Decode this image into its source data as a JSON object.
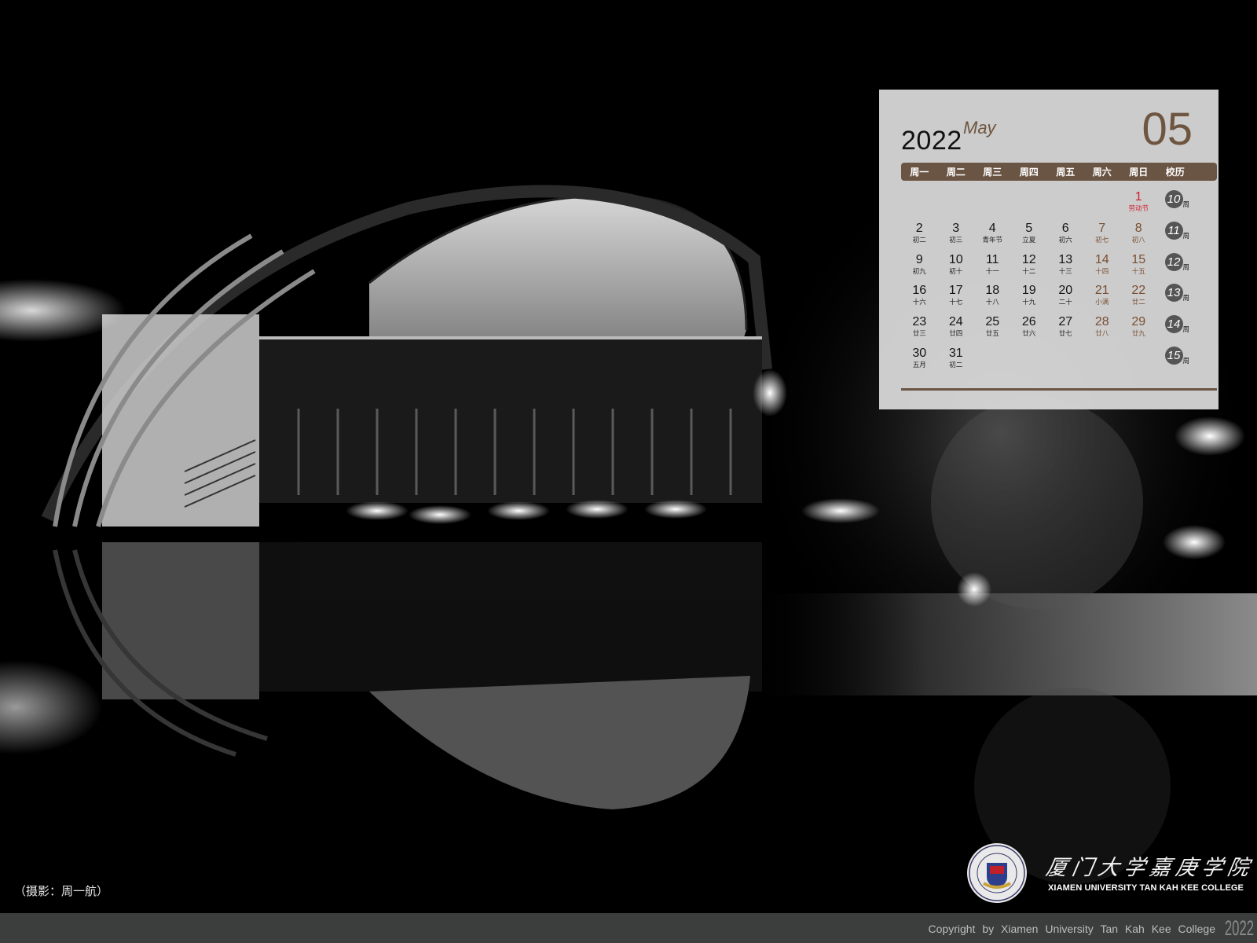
{
  "photo": {
    "subject": "night-reflection-building-photo",
    "tones": {
      "dark": "#000000",
      "light": "#f0f0f0",
      "mid": "#6a6a6a"
    }
  },
  "calendar": {
    "year": "2022",
    "month_en": "May",
    "month_num": "05",
    "colors": {
      "accent": "#6a5443",
      "weekend": "#7a4e31",
      "holiday": "#d11e2b"
    },
    "headers": [
      "周一",
      "周二",
      "周三",
      "周四",
      "周五",
      "周六",
      "周日",
      "校历"
    ],
    "weeks": [
      {
        "days": [
          {
            "n": "",
            "l": ""
          },
          {
            "n": "",
            "l": ""
          },
          {
            "n": "",
            "l": ""
          },
          {
            "n": "",
            "l": ""
          },
          {
            "n": "",
            "l": ""
          },
          {
            "n": "",
            "l": ""
          },
          {
            "n": "1",
            "l": "劳动节"
          }
        ],
        "week_no": "10",
        "suffix": "周"
      },
      {
        "days": [
          {
            "n": "2",
            "l": "初二"
          },
          {
            "n": "3",
            "l": "初三"
          },
          {
            "n": "4",
            "l": "青年节"
          },
          {
            "n": "5",
            "l": "立夏"
          },
          {
            "n": "6",
            "l": "初六"
          },
          {
            "n": "7",
            "l": "初七"
          },
          {
            "n": "8",
            "l": "初八"
          }
        ],
        "week_no": "11",
        "suffix": "周"
      },
      {
        "days": [
          {
            "n": "9",
            "l": "初九"
          },
          {
            "n": "10",
            "l": "初十"
          },
          {
            "n": "11",
            "l": "十一"
          },
          {
            "n": "12",
            "l": "十二"
          },
          {
            "n": "13",
            "l": "十三"
          },
          {
            "n": "14",
            "l": "十四"
          },
          {
            "n": "15",
            "l": "十五"
          }
        ],
        "week_no": "12",
        "suffix": "周"
      },
      {
        "days": [
          {
            "n": "16",
            "l": "十六"
          },
          {
            "n": "17",
            "l": "十七"
          },
          {
            "n": "18",
            "l": "十八"
          },
          {
            "n": "19",
            "l": "十九"
          },
          {
            "n": "20",
            "l": "二十"
          },
          {
            "n": "21",
            "l": "小满"
          },
          {
            "n": "22",
            "l": "廿二"
          }
        ],
        "week_no": "13",
        "suffix": "周"
      },
      {
        "days": [
          {
            "n": "23",
            "l": "廿三"
          },
          {
            "n": "24",
            "l": "廿四"
          },
          {
            "n": "25",
            "l": "廿五"
          },
          {
            "n": "26",
            "l": "廿六"
          },
          {
            "n": "27",
            "l": "廿七"
          },
          {
            "n": "28",
            "l": "廿八"
          },
          {
            "n": "29",
            "l": "廿九"
          }
        ],
        "week_no": "14",
        "suffix": "周"
      },
      {
        "days": [
          {
            "n": "30",
            "l": "五月"
          },
          {
            "n": "31",
            "l": "初二"
          },
          {
            "n": "",
            "l": ""
          },
          {
            "n": "",
            "l": ""
          },
          {
            "n": "",
            "l": ""
          },
          {
            "n": "",
            "l": ""
          },
          {
            "n": "",
            "l": ""
          }
        ],
        "week_no": "15",
        "suffix": "周"
      }
    ]
  },
  "credit": "（摄影：周一航）",
  "college": {
    "name_cn": "厦门大学嘉庚学院",
    "name_en": "XIAMEN UNIVERSITY TAN KAH KEE COLLEGE",
    "logo": "college-seal-logo"
  },
  "footer": {
    "copyright": "Copyright by Xiamen University Tan Kah Kee College",
    "year": "2022"
  }
}
